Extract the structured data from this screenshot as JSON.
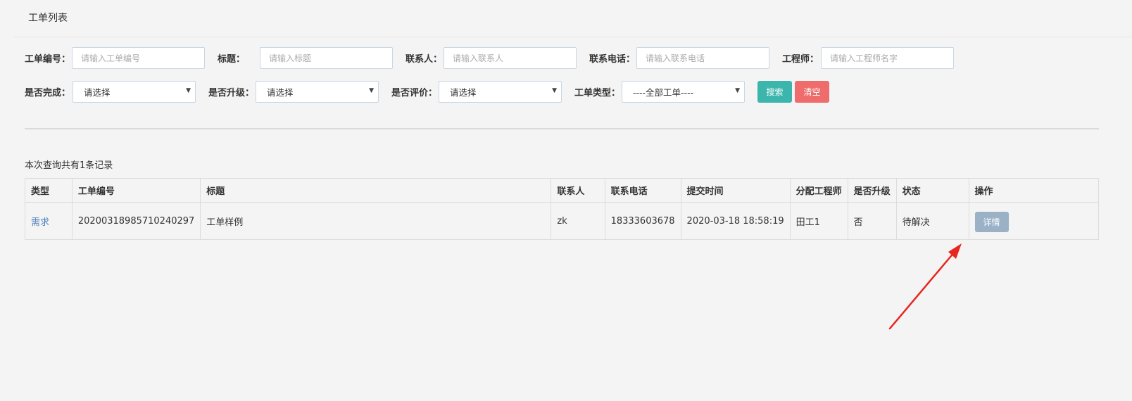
{
  "page": {
    "title": "工单列表"
  },
  "filters": {
    "order_no": {
      "label": "工单编号：",
      "placeholder": "请输入工单编号"
    },
    "title": {
      "label": "标题：",
      "placeholder": "请输入标题"
    },
    "contact": {
      "label": "联系人：",
      "placeholder": "请输入联系人"
    },
    "phone": {
      "label": "联系电话：",
      "placeholder": "请输入联系电话"
    },
    "engineer": {
      "label": "工程师：",
      "placeholder": "请输入工程师名字"
    },
    "completed": {
      "label": "是否完成：",
      "value": "请选择"
    },
    "upgraded": {
      "label": "是否升级：",
      "value": "请选择"
    },
    "evaluated": {
      "label": "是否评价：",
      "value": "请选择"
    },
    "order_type": {
      "label": "工单类型：",
      "value": "----全部工单----"
    },
    "search_label": "搜索",
    "clear_label": "清空"
  },
  "results": {
    "summary": "本次查询共有1条记录",
    "columns": [
      "类型",
      "工单编号",
      "标题",
      "联系人",
      "联系电话",
      "提交时间",
      "分配工程师",
      "是否升级",
      "状态",
      "操作"
    ],
    "rows": [
      {
        "type": "需求",
        "order_no": "20200318985710240297",
        "title": "工单样例",
        "contact": "zk",
        "phone": "18333603678",
        "submit_time": "2020-03-18 18:58:19",
        "engineer": "田工1",
        "upgraded": "否",
        "status": "待解决",
        "action_label": "详情"
      }
    ]
  },
  "colors": {
    "search_button": "#3cb6ad",
    "clear_button": "#ee6c6c",
    "detail_button": "#9bb2c6",
    "link": "#4b7dbd",
    "annotation_arrow": "#e8261e"
  },
  "icons": {
    "select_caret": "caret-down-icon",
    "annotation": "red-arrow-annotation"
  }
}
